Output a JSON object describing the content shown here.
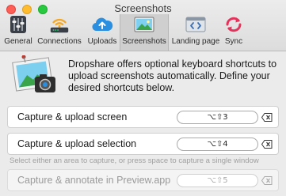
{
  "window": {
    "title": "Screenshots"
  },
  "tabs": [
    {
      "label": "General",
      "icon": "sliders-icon"
    },
    {
      "label": "Connections",
      "icon": "wifi-router-icon"
    },
    {
      "label": "Uploads",
      "icon": "cloud-upload-icon"
    },
    {
      "label": "Screenshots",
      "icon": "landscape-picture-icon",
      "active": true
    },
    {
      "label": "Landing page",
      "icon": "code-window-icon"
    },
    {
      "label": "Sync",
      "icon": "sync-arrows-icon"
    }
  ],
  "info": {
    "text": "Dropshare offers optional keyboard shortcuts to upload screenshots automatically. Define your desired shortcuts below."
  },
  "shortcuts": [
    {
      "label": "Capture & upload screen",
      "keys": "⌥⇧3",
      "enabled": true
    },
    {
      "label": "Capture & upload selection",
      "keys": "⌥⇧4",
      "enabled": true
    },
    {
      "label": "Capture & annotate in  Preview.app",
      "keys": "⌥⇧5",
      "enabled": false
    }
  ],
  "hint": "Select either an area to capture, or press space to capture a single window",
  "colors": {
    "toolbar_bg": "#dcdcdc",
    "window_bg": "#ebebeb",
    "active_tab": "#cfcfcf",
    "sync_icon": "#e5325b"
  }
}
